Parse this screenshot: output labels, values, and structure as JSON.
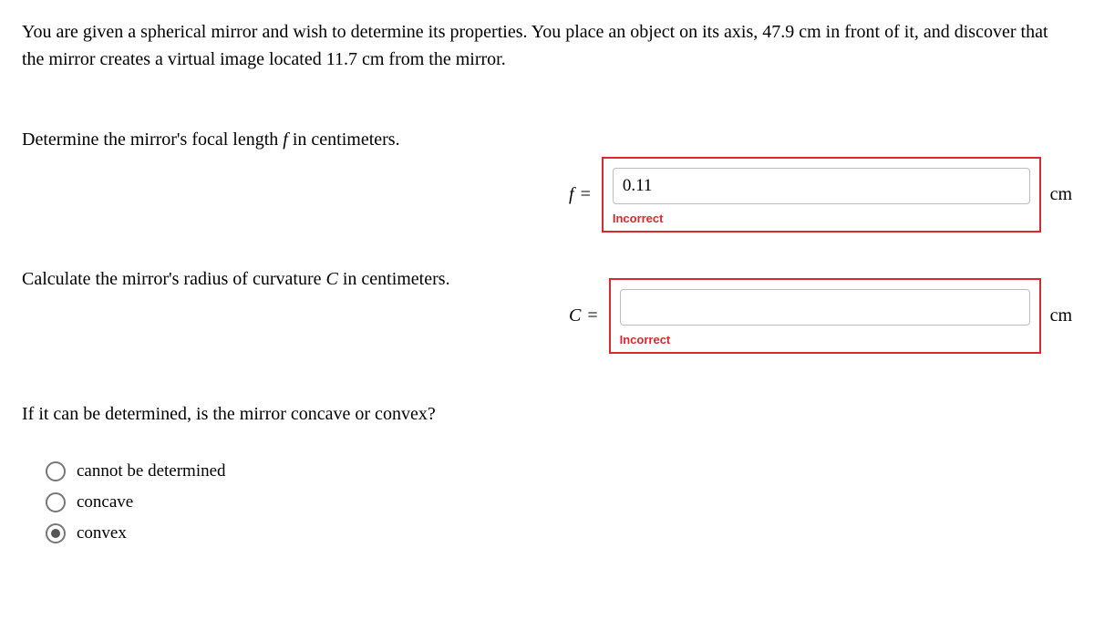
{
  "problem": {
    "statement": "You are given a spherical mirror and wish to determine its properties. You place an object on its axis, 47.9 cm in front of it, and discover that the mirror creates a virtual image located 11.7 cm from the mirror."
  },
  "q1": {
    "prompt_pre": "Determine the mirror's focal length ",
    "prompt_var": "f",
    "prompt_post": " in centimeters.",
    "var_label": "f",
    "equals": "=",
    "value": "0.11",
    "unit": "cm",
    "feedback": "Incorrect"
  },
  "q2": {
    "prompt_pre": "Calculate the mirror's radius of curvature ",
    "prompt_var": "C",
    "prompt_post": " in centimeters.",
    "var_label": "C",
    "equals": "=",
    "value": "",
    "unit": "cm",
    "feedback": "Incorrect"
  },
  "q3": {
    "prompt": "If it can be determined, is the mirror concave or convex?",
    "options": [
      {
        "label": "cannot be determined",
        "selected": false
      },
      {
        "label": "concave",
        "selected": false
      },
      {
        "label": "convex",
        "selected": true
      }
    ]
  }
}
